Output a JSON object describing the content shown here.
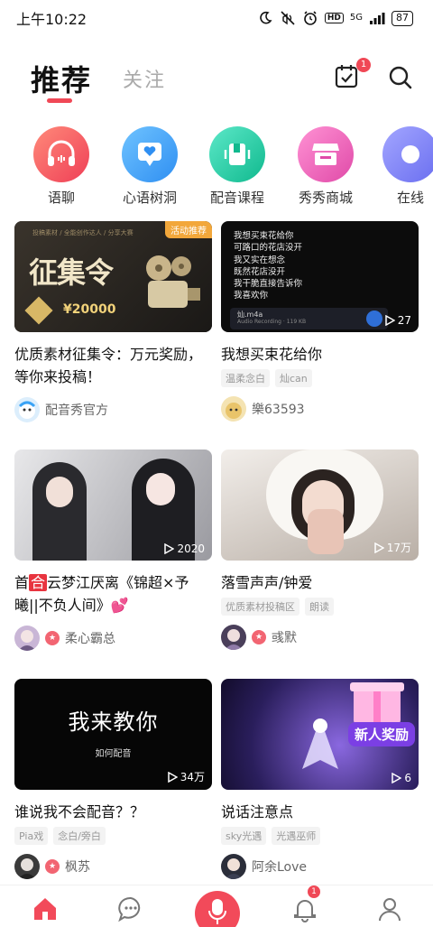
{
  "status_bar": {
    "time": "上午10:22",
    "network": "5G",
    "battery": "87"
  },
  "header": {
    "tab_active": "推荐",
    "tab_inactive": "关注",
    "calendar_badge": "1"
  },
  "categories": [
    {
      "label": "语聊",
      "color": "#f2565f"
    },
    {
      "label": "心语树洞",
      "color": "#3aa3f5"
    },
    {
      "label": "配音课程",
      "color": "#1fc9a5"
    },
    {
      "label": "秀秀商城",
      "color": "#ef5fb6"
    },
    {
      "label": "在线",
      "color": "#7a7cf0"
    }
  ],
  "cards": [
    {
      "thumb_text": {
        "badge": "活动推荐",
        "headline": "征集令",
        "prize": "¥20000",
        "subtitle": "投稿素材 / 全能创作达人 / 分享大赛"
      },
      "title": "优质素材征集令：万元奖励，等你来投稿！",
      "tags": [],
      "author": "配音秀官方",
      "verified": false
    },
    {
      "thumb_text": {
        "lines": [
          "我想买束花给你",
          "可路口的花店没开",
          "我又实在想念",
          "既然花店没开",
          "我干脆直接告诉你",
          "我喜欢你"
        ],
        "file": "灿.m4a",
        "file_sub": "Audio Recording · 119 KB"
      },
      "play_count": "27",
      "title": "我想买束花给你",
      "tags": [
        "温柔念白",
        "灿can"
      ],
      "author": "樂63593",
      "verified": false
    },
    {
      "play_count": "2020",
      "title_prefix": "首",
      "title_red": "合",
      "title_rest": "云梦江厌离《锦超×予曦||不负人间》💕",
      "tags": [],
      "author": "柔心霸总",
      "verified": true
    },
    {
      "play_count": "17万",
      "title": "落雪声声/钟爱",
      "tags": [
        "优质素材投稿区",
        "朗读"
      ],
      "author": "彧默",
      "verified": true
    },
    {
      "thumb_text": {
        "headline": "我来教你",
        "sub": "如何配音"
      },
      "play_count": "34万",
      "title": "谁说我不会配音？？",
      "tags": [
        "Pia戏",
        "念白/旁白"
      ],
      "author": "枫苏",
      "verified": true
    },
    {
      "thumb_text": {
        "ribbon": "新人奖励"
      },
      "play_count": "6",
      "title": "说话注意点",
      "tags": [
        "sky光遇",
        "光遇巫师"
      ],
      "author": "阿余Love",
      "verified": false
    }
  ],
  "bottom_nav": {
    "notify_badge": "1",
    "active_color": "#f24a5a"
  }
}
